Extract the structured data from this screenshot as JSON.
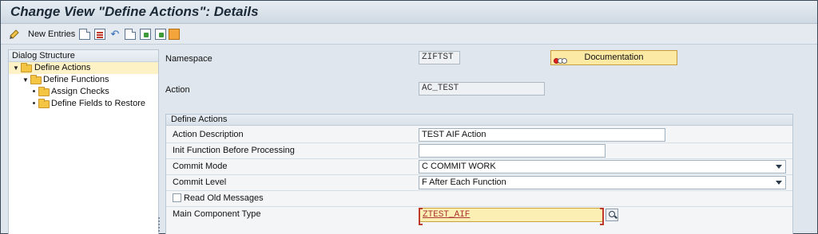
{
  "window": {
    "title": "Change View \"Define Actions\": Details"
  },
  "toolbar": {
    "new_entries_label": "New Entries"
  },
  "dialog_structure": {
    "header": "Dialog Structure",
    "items": [
      {
        "label": "Define Actions",
        "level": 0,
        "expanded": true,
        "selected": true
      },
      {
        "label": "Define Functions",
        "level": 1,
        "expanded": true,
        "selected": false
      },
      {
        "label": "Assign Checks",
        "level": 2,
        "expanded": false,
        "selected": false
      },
      {
        "label": "Define Fields to Restore",
        "level": 2,
        "expanded": false,
        "selected": false
      }
    ]
  },
  "header_fields": {
    "namespace_label": "Namespace",
    "namespace_value": "ZIFTST",
    "documentation_label": "Documentation",
    "action_label": "Action",
    "action_value": "AC_TEST"
  },
  "define_actions": {
    "title": "Define Actions",
    "action_description_label": "Action Description",
    "action_description_value": "TEST AIF Action",
    "init_function_label": "Init Function Before Processing",
    "init_function_value": "",
    "commit_mode_label": "Commit Mode",
    "commit_mode_value": "C COMMIT WORK",
    "commit_level_label": "Commit Level",
    "commit_level_value": "F After Each Function",
    "read_old_messages_label": "Read Old Messages",
    "read_old_messages_checked": false,
    "main_component_type_label": "Main Component Type",
    "main_component_type_value": "ZTEST_AIF"
  },
  "colors": {
    "accent_yellow": "#fbe9a4",
    "selection": "#fdf2c6",
    "required_border": "#c0392b"
  }
}
